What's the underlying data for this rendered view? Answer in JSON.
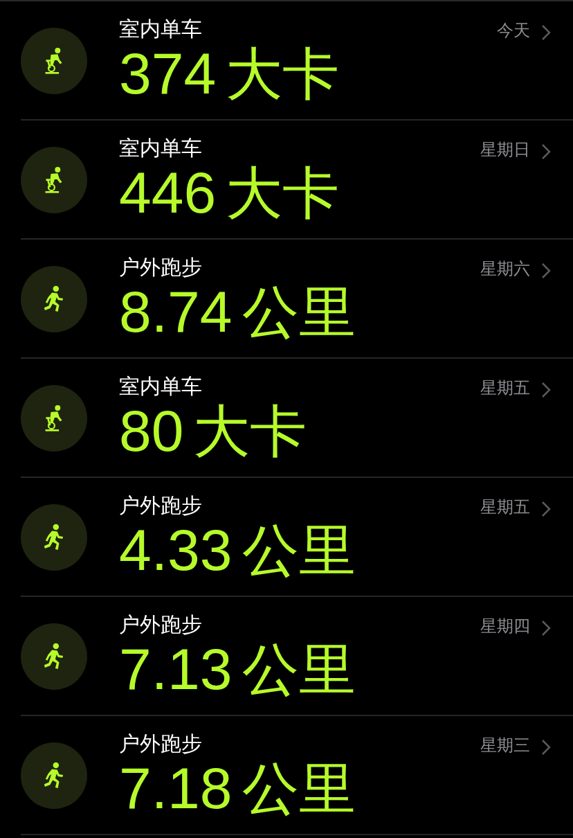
{
  "workouts": [
    {
      "kind": "cycling",
      "title": "室内单车",
      "value": "374",
      "unit": "大卡",
      "day": "今天"
    },
    {
      "kind": "cycling",
      "title": "室内单车",
      "value": "446",
      "unit": "大卡",
      "day": "星期日"
    },
    {
      "kind": "running",
      "title": "户外跑步",
      "value": "8.74",
      "unit": "公里",
      "day": "星期六"
    },
    {
      "kind": "cycling",
      "title": "室内单车",
      "value": "80",
      "unit": "大卡",
      "day": "星期五"
    },
    {
      "kind": "running",
      "title": "户外跑步",
      "value": "4.33",
      "unit": "公里",
      "day": "星期五"
    },
    {
      "kind": "running",
      "title": "户外跑步",
      "value": "7.13",
      "unit": "公里",
      "day": "星期四"
    },
    {
      "kind": "running",
      "title": "户外跑步",
      "value": "7.18",
      "unit": "公里",
      "day": "星期三"
    }
  ]
}
